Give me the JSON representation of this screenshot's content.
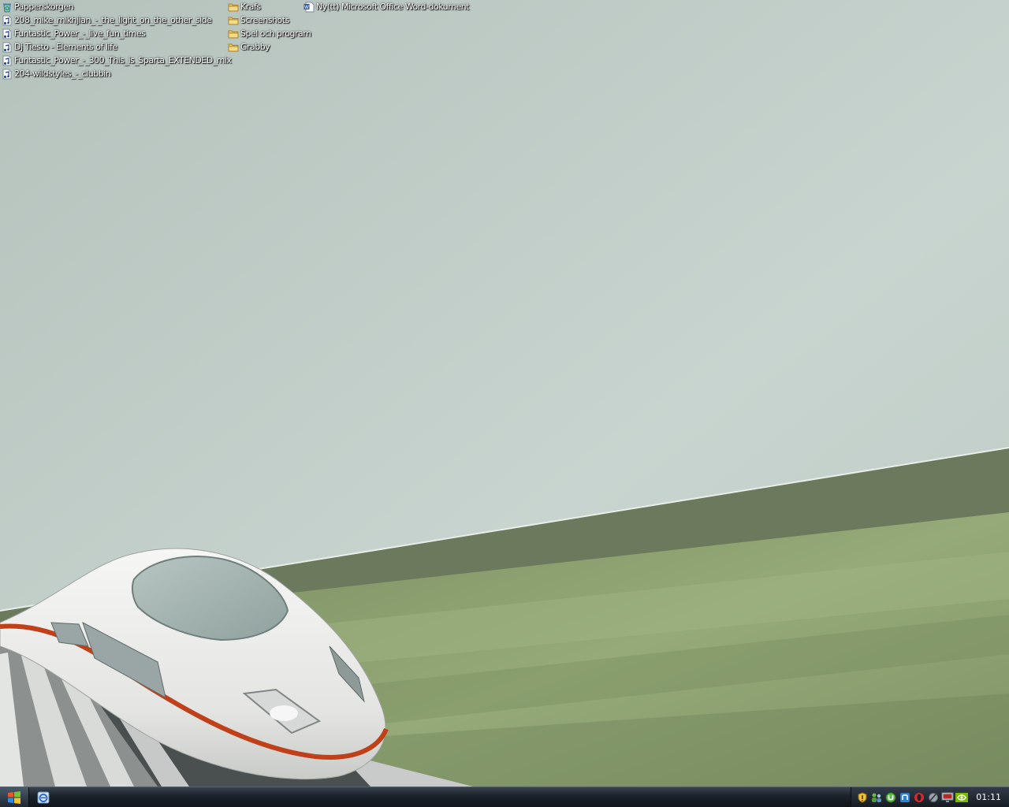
{
  "desktop": {
    "column1": [
      {
        "label": "Papperskorgen",
        "icon": "recycle-bin-icon"
      },
      {
        "label": "208_mike_mikhjian_-_the_light_on_the_other_side",
        "icon": "audio-file-icon"
      },
      {
        "label": "Funtastic_Power_-_live_fun_times",
        "icon": "audio-file-icon"
      },
      {
        "label": "Dj Tiesto - Elements of life",
        "icon": "audio-file-icon"
      },
      {
        "label": "Funtastic_Power_-_300_This_is_Sparta_EXTENDED_mix",
        "icon": "audio-file-icon"
      },
      {
        "label": "204-wildstyles_-_clubbin",
        "icon": "audio-file-icon"
      }
    ],
    "column2": [
      {
        "label": "Krafs",
        "icon": "folder-icon"
      },
      {
        "label": "Screenshots",
        "icon": "folder-icon"
      },
      {
        "label": "Spel och program",
        "icon": "folder-icon"
      },
      {
        "label": "Grabby",
        "icon": "folder-icon"
      }
    ],
    "column3": [
      {
        "label": "Ny(tt) Microsoft Office Word-dokument",
        "icon": "word-document-icon"
      }
    ]
  },
  "taskbar": {
    "start_icon": "windows-logo-icon",
    "quick_launch": [
      "internet-explorer-icon"
    ],
    "tray_icons": [
      "security-shield-icon",
      "network-users-icon",
      "torrent-icon",
      "messenger-icon",
      "opera-icon",
      "volume-icon",
      "display-icon",
      "nvidia-icon"
    ],
    "clock": "01:11"
  },
  "colors": {
    "sky": "#c3d0cb",
    "field_green": "#8fa574",
    "train_stripe": "#c0401a",
    "taskbar": "#1d232c"
  }
}
